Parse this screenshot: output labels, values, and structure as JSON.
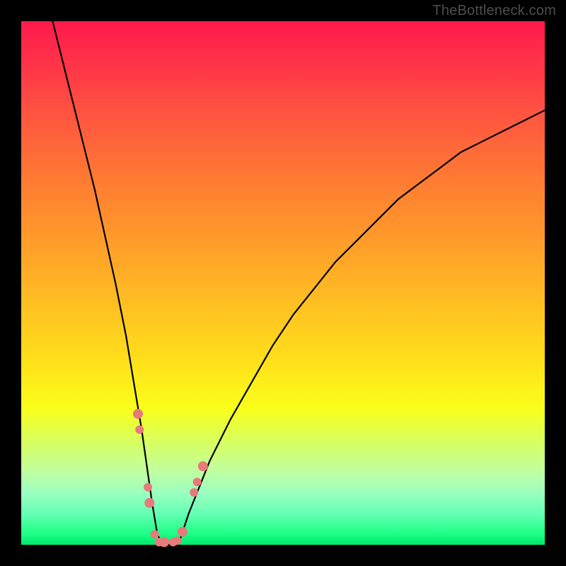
{
  "watermark": "TheBottleneck.com",
  "colors": {
    "frame": "#000000",
    "curve": "#000000",
    "dot": "#e77a7a"
  },
  "chart_data": {
    "type": "line",
    "title": "",
    "xlabel": "",
    "ylabel": "",
    "xlim": [
      0,
      100
    ],
    "ylim": [
      0,
      100
    ],
    "grid": false,
    "series": [
      {
        "name": "curve",
        "x": [
          6,
          8,
          10,
          12,
          14,
          16,
          18,
          20,
          21,
          22,
          23,
          24,
          25,
          26,
          27,
          28,
          29,
          30,
          31,
          32,
          34,
          36,
          38,
          40,
          44,
          48,
          52,
          56,
          60,
          64,
          68,
          72,
          76,
          80,
          84,
          88,
          92,
          96,
          100
        ],
        "y": [
          100,
          92,
          84,
          76,
          68,
          59,
          50,
          40,
          34,
          28,
          22,
          15,
          8,
          2,
          0,
          0,
          0,
          0,
          3,
          6,
          11,
          16,
          20,
          24,
          31,
          38,
          44,
          49,
          54,
          58,
          62,
          66,
          69,
          72,
          75,
          77,
          79,
          81,
          83
        ]
      }
    ],
    "points": [
      {
        "x": 22.3,
        "y": 25
      },
      {
        "x": 22.6,
        "y": 22
      },
      {
        "x": 24.2,
        "y": 11
      },
      {
        "x": 24.5,
        "y": 8
      },
      {
        "x": 25.5,
        "y": 2
      },
      {
        "x": 26.3,
        "y": 0.5
      },
      {
        "x": 27.3,
        "y": 0.5
      },
      {
        "x": 29.0,
        "y": 0.5
      },
      {
        "x": 29.8,
        "y": 0.8
      },
      {
        "x": 30.8,
        "y": 2.5
      },
      {
        "x": 33.0,
        "y": 10
      },
      {
        "x": 33.6,
        "y": 12
      },
      {
        "x": 34.7,
        "y": 15
      }
    ]
  }
}
